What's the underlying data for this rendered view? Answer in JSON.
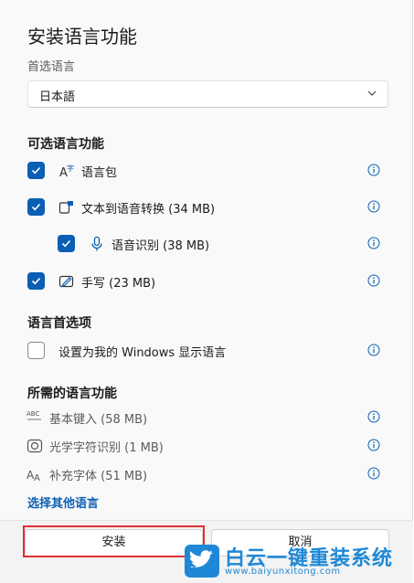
{
  "dialog": {
    "title": "安装语言功能",
    "preferred_language_label": "首选语言",
    "preferred_language_value": "日本語"
  },
  "optional_features": {
    "heading": "可选语言功能",
    "items": [
      {
        "label": "语言包",
        "checked": true,
        "icon": "language-pack-icon"
      },
      {
        "label": "文本到语音转换 (34 MB)",
        "checked": true,
        "icon": "text-to-speech-icon"
      },
      {
        "label": "语音识别 (38 MB)",
        "checked": true,
        "icon": "microphone-icon"
      },
      {
        "label": "手写 (23 MB)",
        "checked": true,
        "icon": "handwriting-icon"
      }
    ]
  },
  "preferences": {
    "heading": "语言首选项",
    "display_language_label": "设置为我的 Windows 显示语言",
    "display_language_checked": false
  },
  "required_features": {
    "heading": "所需的语言功能",
    "items": [
      {
        "label": "基本键入 (58 MB)",
        "icon": "abc-typing-icon"
      },
      {
        "label": "光学字符识别 (1 MB)",
        "icon": "ocr-icon"
      },
      {
        "label": "补充字体 (51 MB)",
        "icon": "font-icon"
      }
    ]
  },
  "link_other_language": "选择其他语言",
  "buttons": {
    "install": "安装",
    "cancel": "取消"
  },
  "watermark": {
    "name": "白云一键重装系统",
    "url": "www.baiyunxitong.com"
  },
  "colors": {
    "accent": "#0a5fb4",
    "highlight": "#e03030",
    "watermark": "#1e88d6"
  }
}
